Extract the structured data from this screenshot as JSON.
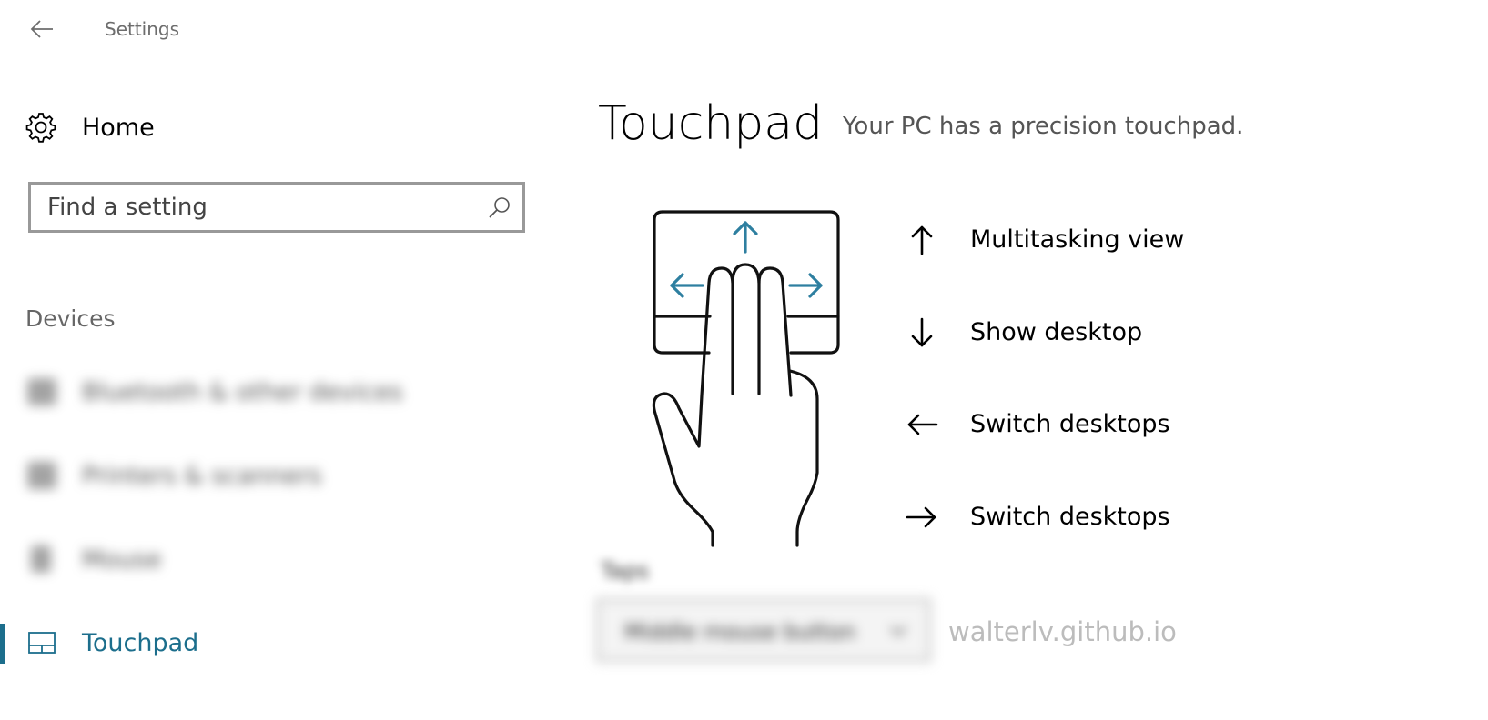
{
  "window": {
    "title": "Settings",
    "back_icon": "back-arrow-icon"
  },
  "sidebar": {
    "home": {
      "label": "Home",
      "icon": "gear-icon"
    },
    "search": {
      "placeholder": "Find a setting",
      "icon": "search-icon"
    },
    "section_header": "Devices",
    "items": [
      {
        "label": "Bluetooth & other devices",
        "icon": "bluetooth-devices-icon",
        "blurred": true
      },
      {
        "label": "Printers & scanners",
        "icon": "printer-icon",
        "blurred": true
      },
      {
        "label": "Mouse",
        "icon": "mouse-icon",
        "blurred": true
      },
      {
        "label": "Touchpad",
        "icon": "touchpad-icon",
        "active": true
      }
    ]
  },
  "main": {
    "title": "Touchpad",
    "subtitle": "Your PC has a precision touchpad.",
    "illustration": "touchpad-three-finger-gesture-illustration",
    "gestures": [
      {
        "direction": "up",
        "icon": "arrow-up-icon",
        "label": "Multitasking view"
      },
      {
        "direction": "down",
        "icon": "arrow-down-icon",
        "label": "Show desktop"
      },
      {
        "direction": "left",
        "icon": "arrow-left-icon",
        "label": "Switch desktops"
      },
      {
        "direction": "right",
        "icon": "arrow-right-icon",
        "label": "Switch desktops"
      }
    ],
    "taps": {
      "label": "Taps",
      "selected": "Middle mouse button",
      "blurred": true
    }
  },
  "watermark": "walterlv.github.io",
  "colors": {
    "accent": "#1c6e8c",
    "gesture_arrow": "#2e7fa0",
    "text_secondary": "#555555",
    "watermark": "#bcbcbc"
  }
}
